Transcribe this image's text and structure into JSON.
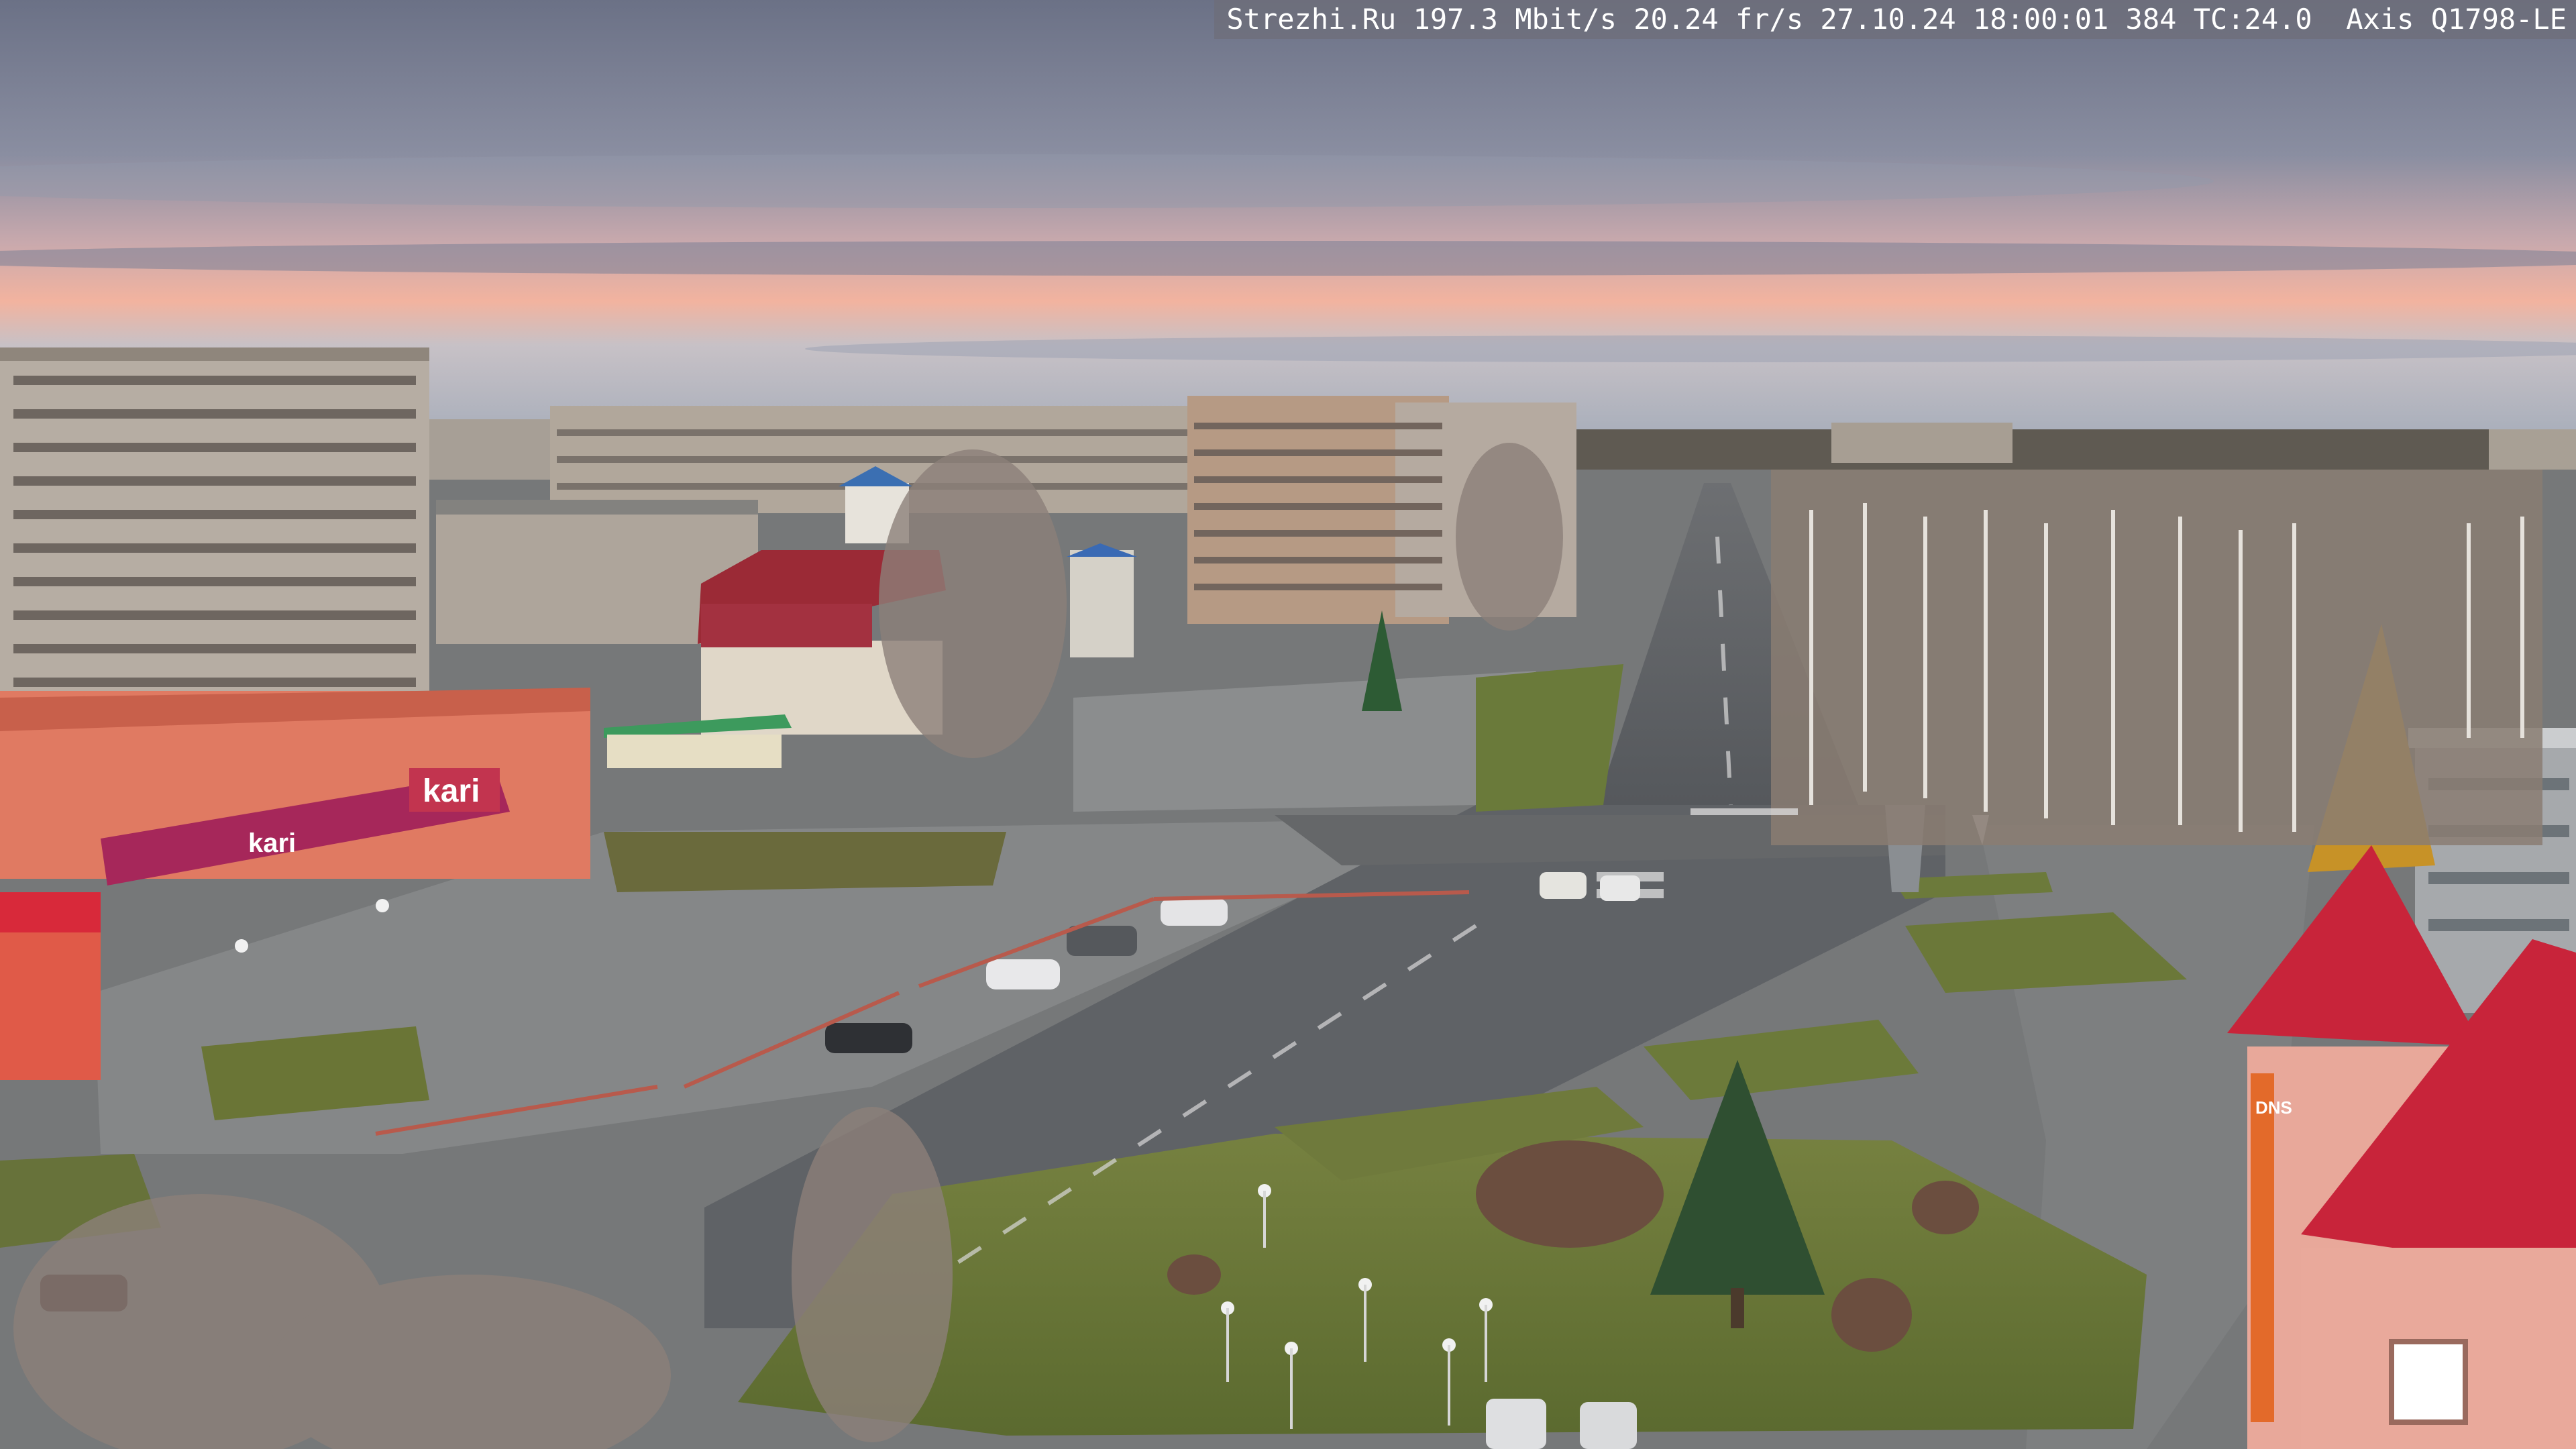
{
  "camera_overlay": {
    "text": "Strezhi.Ru 197.3 Mbit/s 20.24 fr/s 27.10.24 18:00:01 384 TC:24.0  Axis Q1798-LE"
  },
  "signs": {
    "kari_store": "kari",
    "kari_banner": "kari",
    "dns_store": "DNS"
  },
  "colors": {
    "sky_top": "#6e7488",
    "sunset_band": "#f2b3a0",
    "storefront_pink": "#c2344f",
    "roof_red": "#c8243a",
    "grass": "#6f7c3b"
  }
}
